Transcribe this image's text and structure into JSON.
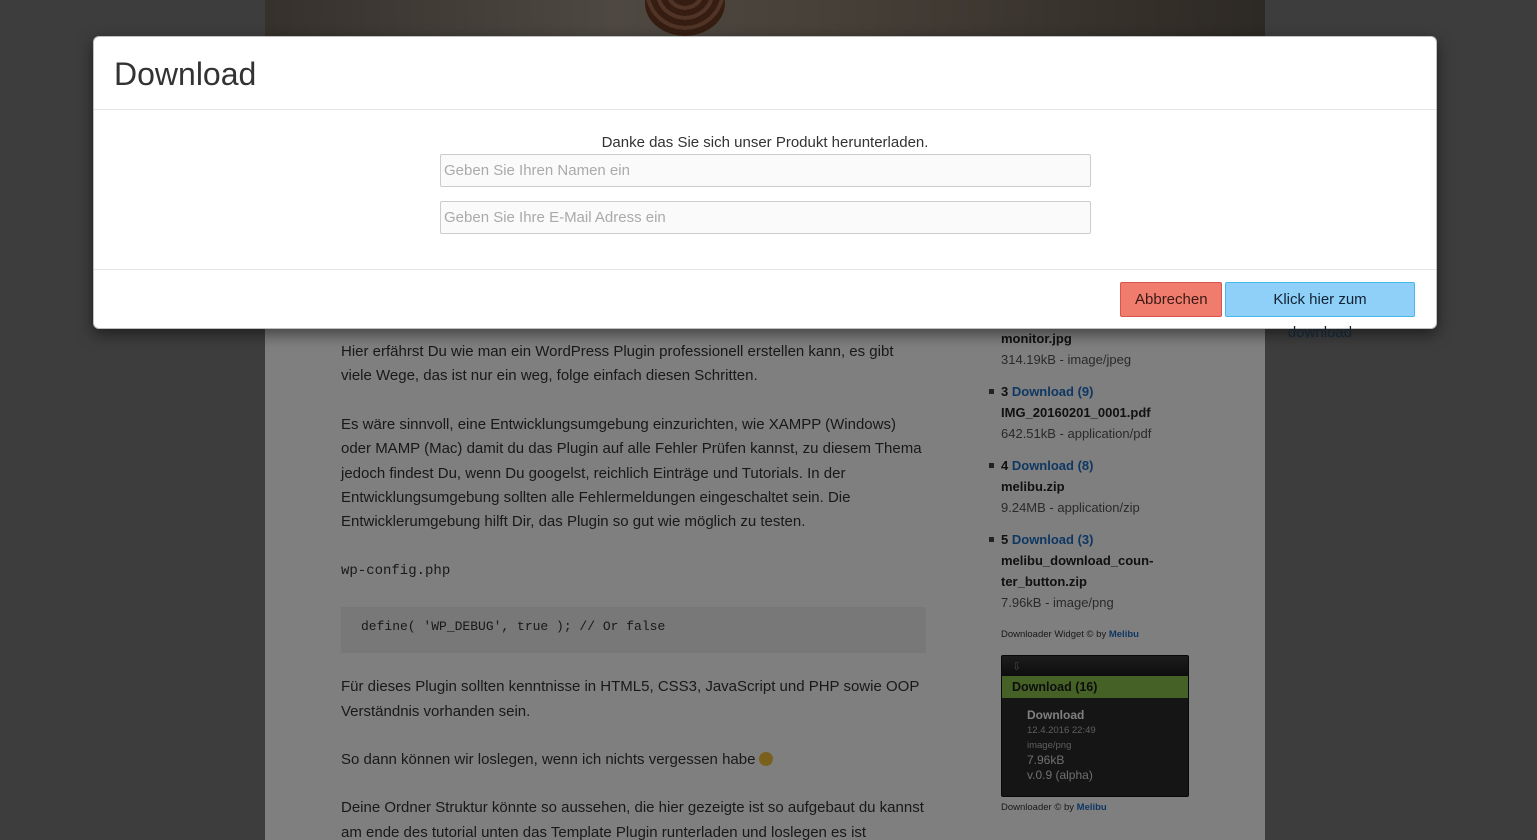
{
  "modal": {
    "title": "Download",
    "intro": "Danke das Sie sich unser Produkt herunterladen.",
    "name_placeholder": "Geben Sie Ihren Namen ein",
    "email_placeholder": "Geben Sie Ihre E-Mail Adress ein",
    "cancel_label": "Abbrechen",
    "download_label": "Klick hier zum download",
    "cancel_color": "#ef7c6c",
    "download_color": "#8fd0f8"
  },
  "article": {
    "p1": "Hier erfährst Du wie man ein WordPress Plugin professionell erstellen kann, es gibt viele Wege, das ist nur ein weg, folge einfach diesen Schritten.",
    "p2": "Es wäre sinnvoll, eine Entwicklungsumgebung einzurichten, wie XAMPP (Windows) oder MAMP (Mac) damit du das Plugin auf alle Fehler Prüfen kannst, zu diesem Thema jedoch findest Du, wenn Du googelst, reichlich Einträge und Tutorials. In der Entwicklungsumgebung sollten alle Fehlermeldungen eingeschaltet sein. Die Entwicklerumgebung hilft Dir, das Plugin so gut wie möglich zu testen.",
    "filename": "wp-config.php",
    "code": "define( 'WP_DEBUG', true ); // Or false",
    "p3": "Für dieses Plugin sollten kenntnisse in HTML5, CSS3, JavaScript und PHP sowie OOP Verständnis vorhanden sein.",
    "p4": "So dann können wir loslegen, wenn ich nichts vergessen habe",
    "p5": "Deine Ordner Struktur könnte so aussehen, die hier gezeigte ist so aufgebaut du kannst am ende des tutorial unten das Template Plugin runterladen und loslegen es ist"
  },
  "sidebar": {
    "top_item": {
      "file": "monitor.jpg",
      "meta": "314.19kB - image/jpeg"
    },
    "items": [
      {
        "num": "3",
        "link": "Download (9)",
        "file": "IMG_20160201_0001.pdf",
        "meta": "642.51kB - application/pdf"
      },
      {
        "num": "4",
        "link": "Download (8)",
        "file": "melibu.zip",
        "meta": "9.24MB - application/zip"
      },
      {
        "num": "5",
        "link": "Download (3)",
        "file": "melibu_download_coun-ter_button.zip",
        "meta": "7.96kB - image/png"
      }
    ],
    "credit_prefix": "Downloader Widget © by",
    "credit_link": "Melibu"
  },
  "download_widget": {
    "bar_label": "Download (16)",
    "title": "Download",
    "date": "12.4.2016 22:49",
    "type": "image/png",
    "size": "7.96kB",
    "version": "v.0.9 (alpha)",
    "credit_prefix": "Downloader © by",
    "credit_link": "Melibu",
    "bar_color": "#8bc34a"
  }
}
